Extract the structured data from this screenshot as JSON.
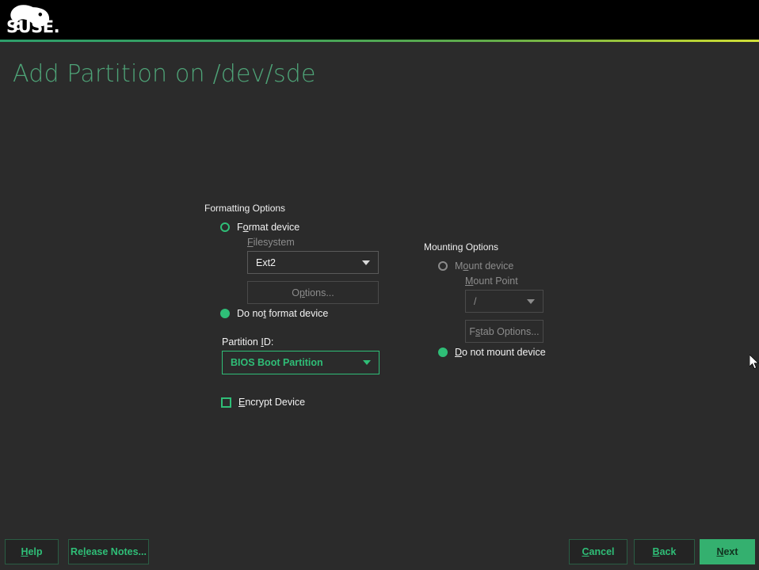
{
  "header": {
    "logo_icon": "suse-chameleon-logo",
    "logo_text": "SUSE."
  },
  "page": {
    "title": "Add Partition on /dev/sde"
  },
  "formatting": {
    "group_label": "Formatting Options",
    "format_device": {
      "label_pre": "F",
      "label_mn": "o",
      "label_post": "rmat device",
      "selected": false
    },
    "filesystem_label_pre": "",
    "filesystem_label_mn": "F",
    "filesystem_label_post": "ilesystem",
    "filesystem_value": "Ext2",
    "options_button": {
      "label_pre": "O",
      "label_mn": "p",
      "label_post": "tions...",
      "enabled": false
    },
    "do_not_format": {
      "label_pre": "Do no",
      "label_mn": "t",
      "label_post": " format device",
      "selected": true
    },
    "partition_id_label_pre": "Partition ",
    "partition_id_label_mn": "I",
    "partition_id_label_post": "D:",
    "partition_id_value": "BIOS Boot Partition",
    "encrypt_device": {
      "label_pre": "",
      "label_mn": "E",
      "label_post": "ncrypt Device",
      "checked": false
    }
  },
  "mounting": {
    "group_label": "Mounting Options",
    "mount_device": {
      "label_pre": "M",
      "label_mn": "o",
      "label_post": "unt device",
      "selected": false
    },
    "mount_point_label_pre": "",
    "mount_point_label_mn": "M",
    "mount_point_label_post": "ount Point",
    "mount_point_value": "/",
    "fstab_button": {
      "label_pre": "F",
      "label_mn": "s",
      "label_post": "tab Options...",
      "enabled": false
    },
    "do_not_mount": {
      "label_pre": "",
      "label_mn": "D",
      "label_post": "o not mount device",
      "selected": true
    }
  },
  "footer": {
    "help": {
      "label_pre": "",
      "label_mn": "H",
      "label_post": "elp"
    },
    "release_notes": {
      "label_pre": "Re",
      "label_mn": "l",
      "label_post": "ease Notes..."
    },
    "cancel": {
      "label_pre": "",
      "label_mn": "C",
      "label_post": "ancel"
    },
    "back": {
      "label_pre": "",
      "label_mn": "B",
      "label_post": "ack"
    },
    "next": {
      "label_pre": "",
      "label_mn": "N",
      "label_post": "ext"
    }
  },
  "colors": {
    "accent_green": "#2fbe77",
    "title_green": "#4ea377",
    "primary_button": "#34b06f",
    "background": "#2b2b2b",
    "header_black": "#000000",
    "disabled_text": "#8c8c8c"
  }
}
